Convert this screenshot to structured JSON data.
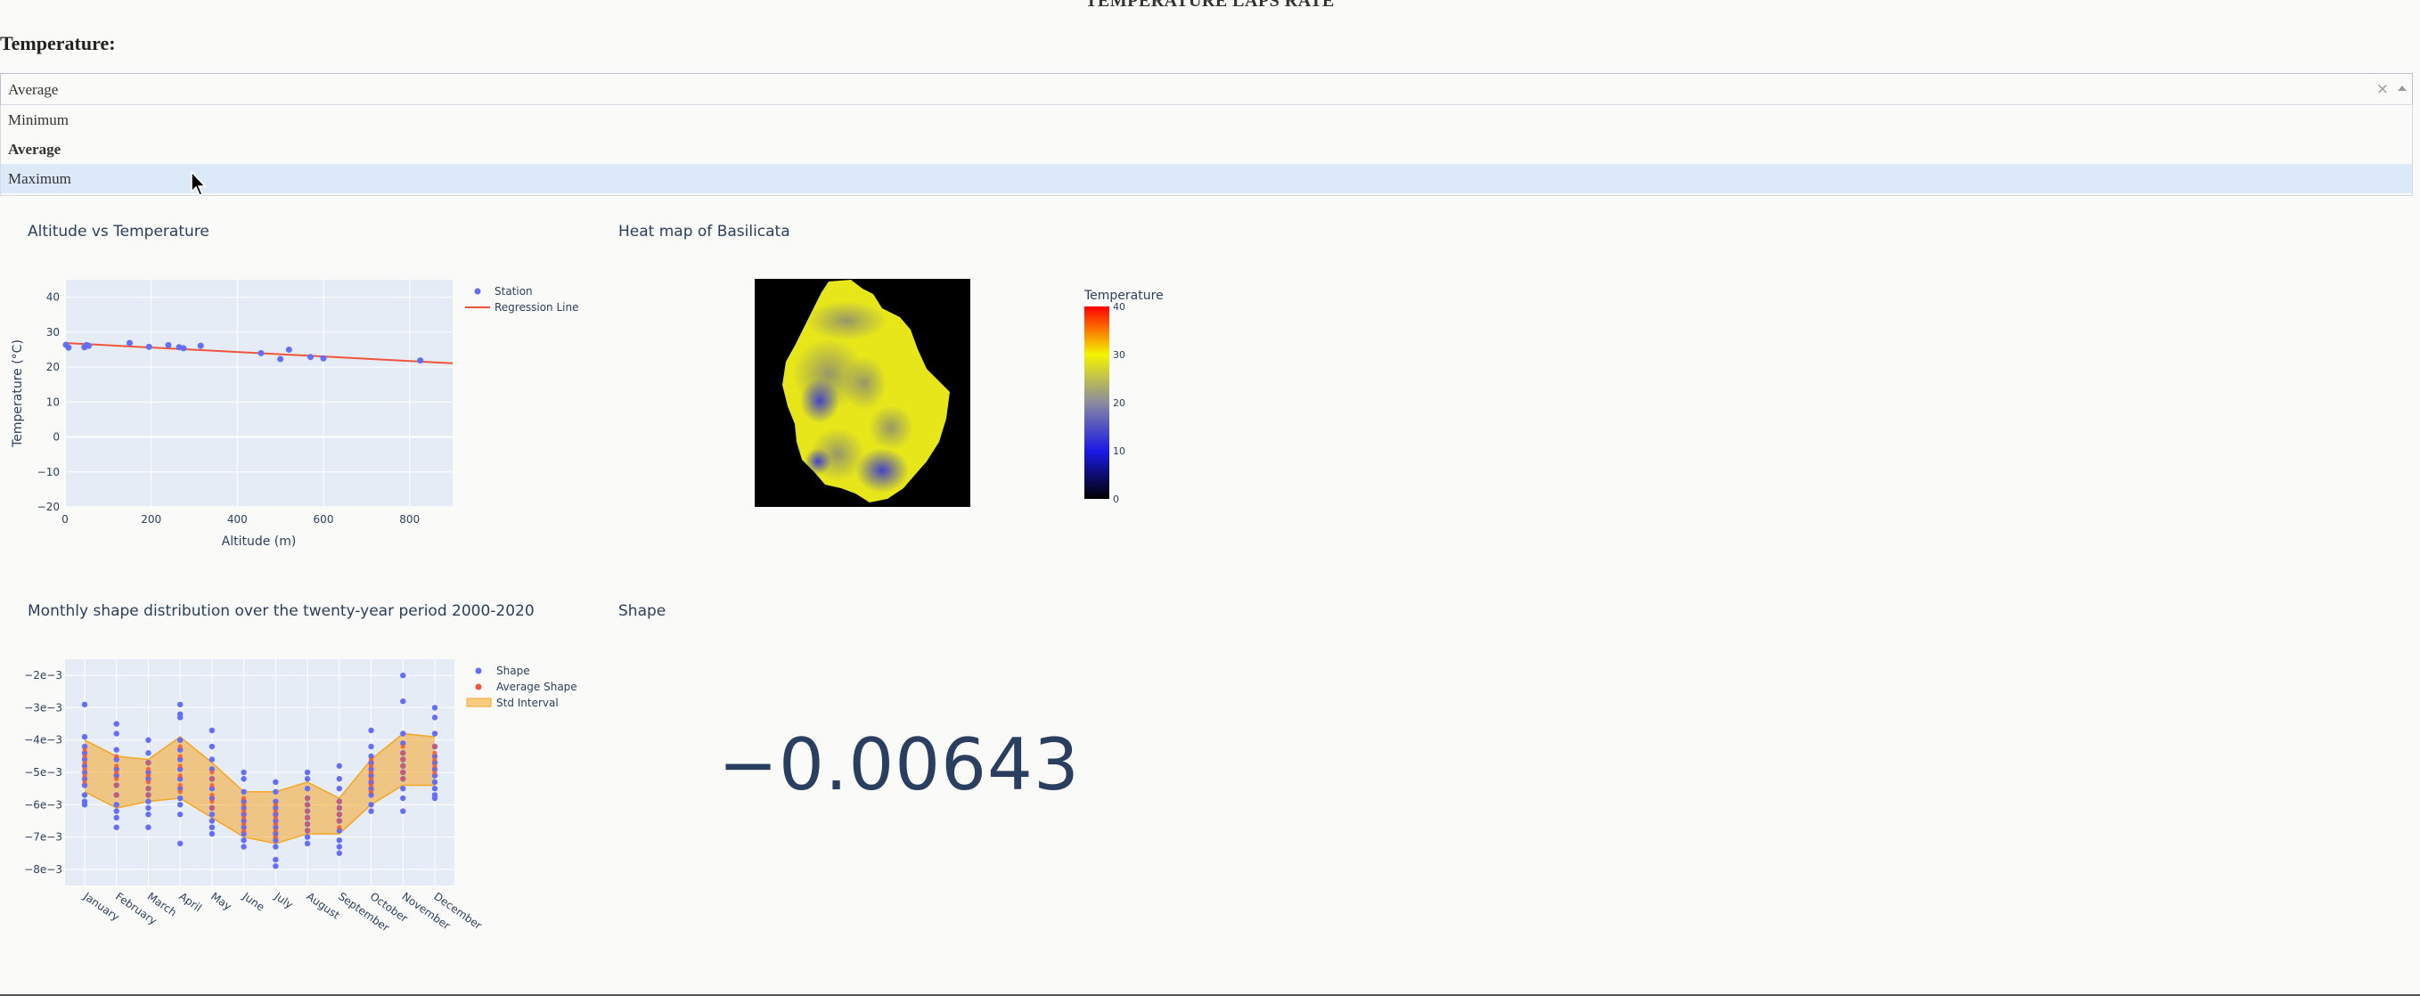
{
  "header": {
    "title": "TEMPERATURE LAPS RATE"
  },
  "temperature": {
    "label": "Temperature:",
    "selected": "Average",
    "clear": "×",
    "options": [
      "Minimum",
      "Average",
      "Maximum"
    ],
    "hovered_option": "Maximum"
  },
  "plot1_title": "Altitude vs Temperature",
  "plot2_title": "Heat map of Basilicata",
  "plot3_title": "Monthly shape distribution over the twenty-year period 2000-2020",
  "plot4_title": "Shape",
  "shape_value": "−0.00643",
  "colors": {
    "station": "#636efa",
    "regression": "#ef553b",
    "band": "#f5a623",
    "avg": "#ef553b"
  },
  "chart_data": [
    {
      "type": "scatter",
      "xlabel": "Altitude (m)",
      "ylabel": "Temperature (°C)",
      "xlim": [
        0,
        900
      ],
      "ylim": [
        -20,
        45
      ],
      "x_ticks": [
        0,
        200,
        400,
        600,
        800
      ],
      "y_ticks": [
        -20,
        -10,
        0,
        10,
        20,
        30,
        40
      ],
      "legend_position": "right",
      "series": [
        {
          "name": "Station",
          "mode": "markers",
          "x": [
            2,
            8,
            45,
            50,
            55,
            150,
            195,
            240,
            265,
            275,
            315,
            455,
            500,
            520,
            570,
            600,
            825
          ],
          "y": [
            26.4,
            25.6,
            25.7,
            26.3,
            26.1,
            26.9,
            25.8,
            26.3,
            25.7,
            25.4,
            26.1,
            24.0,
            22.3,
            25.0,
            22.9,
            22.5,
            21.9
          ]
        },
        {
          "name": "Regression Line",
          "mode": "line",
          "x": [
            0,
            900
          ],
          "y": [
            26.9,
            21.1
          ]
        }
      ]
    },
    {
      "type": "heatmap",
      "colorbar_title": "Temperature",
      "colorbar_ticks": [
        0,
        10,
        20,
        30,
        40
      ],
      "zlim": [
        0,
        40
      ],
      "colorscale": [
        "#000000",
        "#1a1ae6",
        "#8a8aa0",
        "#f4f400",
        "#ff0000"
      ]
    },
    {
      "type": "scatter",
      "categories": [
        "January",
        "February",
        "March",
        "April",
        "May",
        "June",
        "July",
        "August",
        "September",
        "October",
        "November",
        "December"
      ],
      "y_ticks": [
        -0.002,
        -0.003,
        -0.004,
        -0.005,
        -0.006,
        -0.007,
        -0.008
      ],
      "y_tick_labels": [
        "−2e−3",
        "−3e−3",
        "−4e−3",
        "−5e−3",
        "−6e−3",
        "−7e−3",
        "−8e−3"
      ],
      "ylim": [
        -0.0085,
        -0.0015
      ],
      "legend_position": "right",
      "series": [
        {
          "name": "Shape",
          "mode": "markers",
          "values": [
            [
              -0.0029,
              -0.0039,
              -0.0042,
              -0.0044,
              -0.0046,
              -0.0048,
              -0.005,
              -0.0052,
              -0.0054,
              -0.0057,
              -0.0059,
              -0.006
            ],
            [
              -0.0035,
              -0.0038,
              -0.0043,
              -0.0046,
              -0.0049,
              -0.0051,
              -0.0054,
              -0.0057,
              -0.006,
              -0.0062,
              -0.0064,
              -0.0067
            ],
            [
              -0.004,
              -0.0044,
              -0.0047,
              -0.005,
              -0.0052,
              -0.0055,
              -0.0057,
              -0.0059,
              -0.0061,
              -0.0063,
              -0.0067
            ],
            [
              -0.0029,
              -0.0032,
              -0.0033,
              -0.004,
              -0.0043,
              -0.0046,
              -0.0049,
              -0.0052,
              -0.0055,
              -0.0058,
              -0.006,
              -0.0063,
              -0.0072
            ],
            [
              -0.0037,
              -0.0042,
              -0.0046,
              -0.0049,
              -0.0052,
              -0.0055,
              -0.0058,
              -0.0061,
              -0.0063,
              -0.0065,
              -0.0067,
              -0.0069
            ],
            [
              -0.005,
              -0.0052,
              -0.0056,
              -0.0059,
              -0.0061,
              -0.0063,
              -0.0065,
              -0.0067,
              -0.0069,
              -0.0071,
              -0.0073
            ],
            [
              -0.0053,
              -0.0056,
              -0.0059,
              -0.0061,
              -0.0063,
              -0.0065,
              -0.0067,
              -0.0069,
              -0.0071,
              -0.0073,
              -0.0077,
              -0.0079
            ],
            [
              -0.005,
              -0.0052,
              -0.0055,
              -0.0058,
              -0.006,
              -0.0062,
              -0.0064,
              -0.0066,
              -0.0068,
              -0.007,
              -0.0072
            ],
            [
              -0.0048,
              -0.0052,
              -0.0055,
              -0.0059,
              -0.0061,
              -0.0063,
              -0.0065,
              -0.0068,
              -0.0071,
              -0.0073,
              -0.0075
            ],
            [
              -0.0037,
              -0.0042,
              -0.0045,
              -0.0047,
              -0.0049,
              -0.0051,
              -0.0053,
              -0.0055,
              -0.0057,
              -0.006,
              -0.0062
            ],
            [
              -0.002,
              -0.0028,
              -0.0038,
              -0.0041,
              -0.0044,
              -0.0046,
              -0.0048,
              -0.005,
              -0.0052,
              -0.0055,
              -0.0058,
              -0.0062
            ],
            [
              -0.003,
              -0.0033,
              -0.0038,
              -0.0042,
              -0.0045,
              -0.0047,
              -0.0049,
              -0.0051,
              -0.0053,
              -0.0055,
              -0.0057,
              -0.0058
            ]
          ]
        },
        {
          "name": "Average Shape",
          "mode": "markers",
          "values": [
            [
              -0.0043,
              -0.0045,
              -0.0047,
              -0.0049,
              -0.0051,
              -0.0053
            ],
            [
              -0.0045,
              -0.0048,
              -0.005,
              -0.0052,
              -0.0054,
              -0.0057
            ],
            [
              -0.0047,
              -0.0049,
              -0.0051,
              -0.0053,
              -0.0055,
              -0.0057
            ],
            [
              -0.0042,
              -0.0045,
              -0.0048,
              -0.0051,
              -0.0054,
              -0.0056
            ],
            [
              -0.005,
              -0.0052,
              -0.0054,
              -0.0057,
              -0.0059,
              -0.0061
            ],
            [
              -0.0058,
              -0.006,
              -0.0062,
              -0.0064,
              -0.0066,
              -0.0068
            ],
            [
              -0.006,
              -0.0062,
              -0.0064,
              -0.0066,
              -0.0068,
              -0.007
            ],
            [
              -0.0058,
              -0.006,
              -0.0062,
              -0.0064,
              -0.0066,
              -0.0068
            ],
            [
              -0.0059,
              -0.0061,
              -0.0063,
              -0.0065,
              -0.0067
            ],
            [
              -0.0046,
              -0.0048,
              -0.005,
              -0.0052,
              -0.0054,
              -0.0056
            ],
            [
              -0.0042,
              -0.0044,
              -0.0046,
              -0.0048,
              -0.005,
              -0.0052
            ],
            [
              -0.0042,
              -0.0044,
              -0.0046,
              -0.0048,
              -0.005
            ]
          ]
        },
        {
          "name": "Std Interval",
          "mode": "band",
          "upper": [
            -0.004,
            -0.0045,
            -0.0046,
            -0.0039,
            -0.0047,
            -0.0056,
            -0.0056,
            -0.0053,
            -0.0058,
            -0.0046,
            -0.0038,
            -0.0039
          ],
          "lower": [
            -0.0056,
            -0.0061,
            -0.0059,
            -0.0058,
            -0.0064,
            -0.007,
            -0.0072,
            -0.0069,
            -0.0069,
            -0.006,
            -0.0054,
            -0.0054
          ]
        }
      ]
    }
  ]
}
